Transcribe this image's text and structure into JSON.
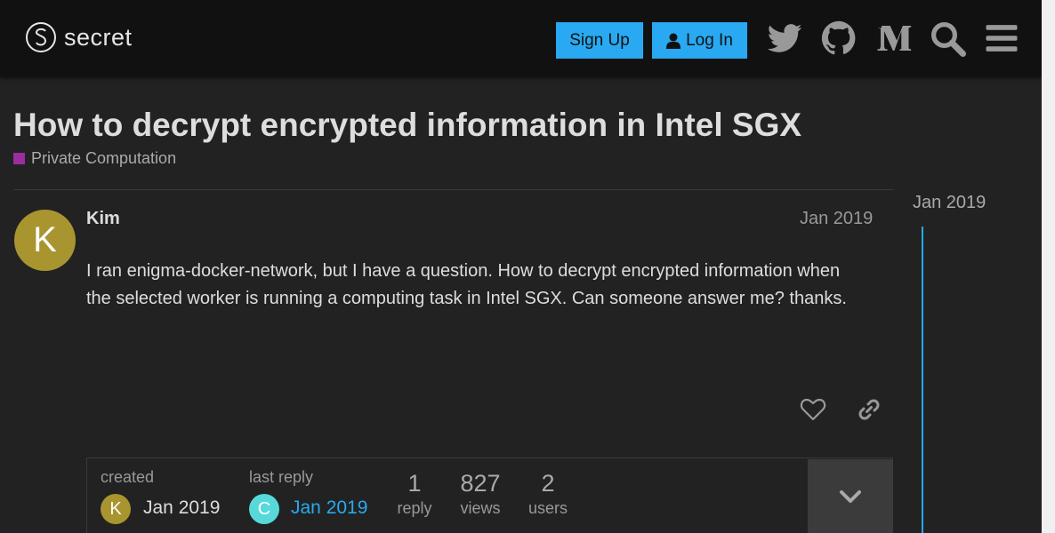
{
  "header": {
    "logo_text": "secret",
    "signup_label": "Sign Up",
    "login_label": "Log In",
    "icons": [
      "twitter-icon",
      "github-icon",
      "medium-icon",
      "search-icon",
      "hamburger-menu-icon"
    ]
  },
  "topic": {
    "title": "How to decrypt encrypted information in Intel SGX",
    "category": "Private Computation",
    "category_color": "#9a2d9f"
  },
  "post": {
    "avatar_letter": "K",
    "avatar_color": "#a8952f",
    "username": "Kim",
    "date": "Jan 2019",
    "body": "I ran enigma-docker-network, but I have a question. How to decrypt encrypted information when the selected worker is running a computing task in Intel SGX. Can someone answer me? thanks."
  },
  "topic_map": {
    "created_label": "created",
    "created_avatar_letter": "K",
    "created_date": "Jan 2019",
    "last_reply_label": "last reply",
    "last_reply_avatar_letter": "C",
    "last_reply_avatar_color": "#57d9db",
    "last_reply_date": "Jan 2019",
    "stats": [
      {
        "number": "1",
        "label": "reply"
      },
      {
        "number": "827",
        "label": "views"
      },
      {
        "number": "2",
        "label": "users"
      }
    ]
  },
  "timeline": {
    "date": "Jan 2019"
  },
  "colors": {
    "accent": "#28a9f1",
    "background": "#222222",
    "header": "#111111"
  }
}
